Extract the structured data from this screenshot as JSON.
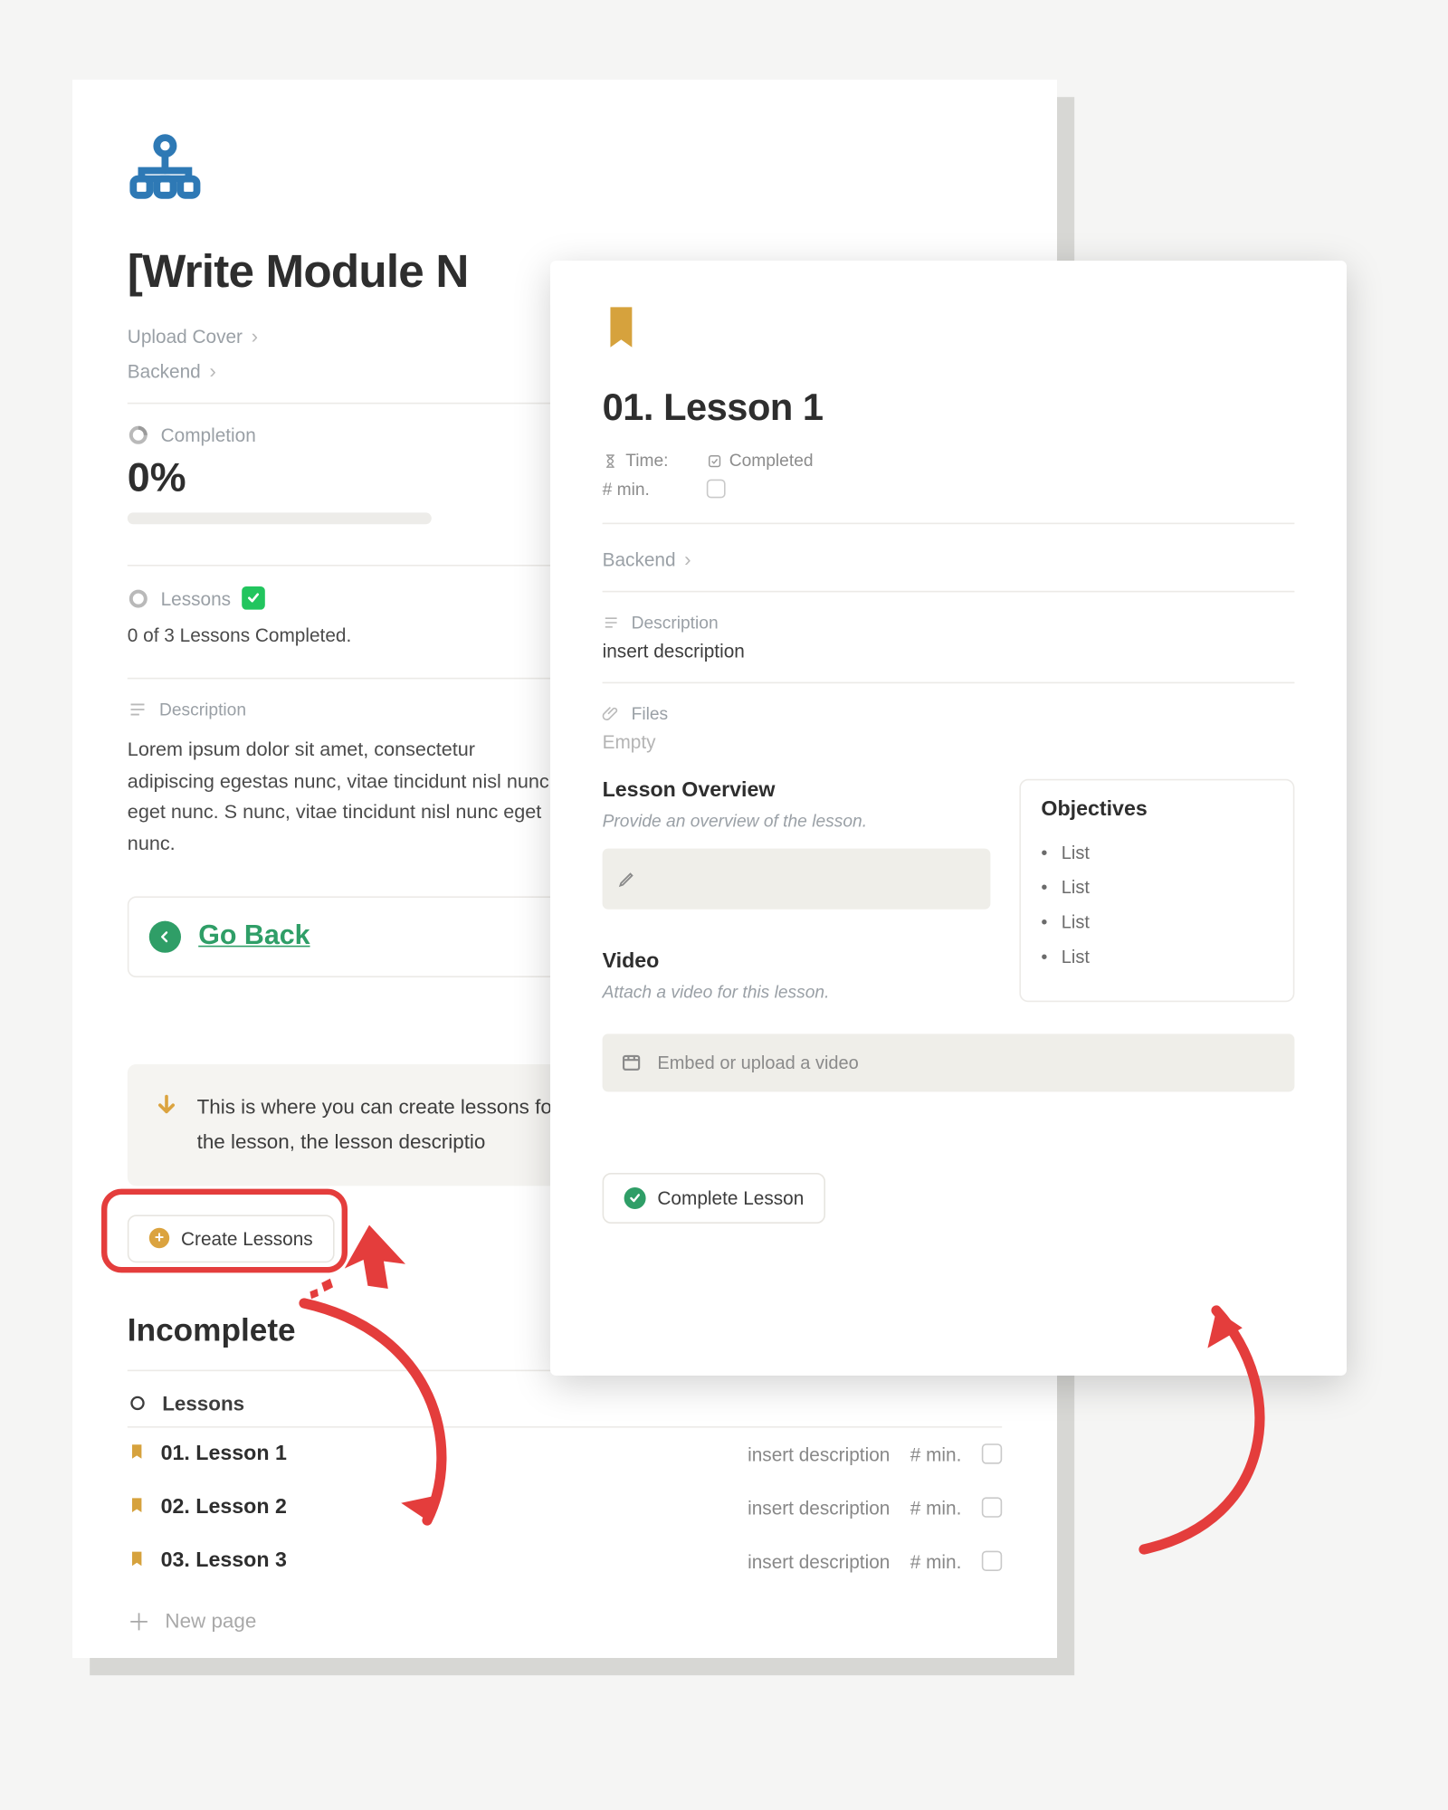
{
  "module": {
    "title": "[Write Module N",
    "upload_cover": "Upload Cover",
    "breadcrumb": "Backend",
    "completion_label": "Completion",
    "completion_value": "0%",
    "lessons_label": "Lessons",
    "lessons_progress": "0 of 3 Lessons Completed.",
    "description_label": "Description",
    "description_text": "Lorem ipsum dolor sit amet, consectetur adipiscing egestas nunc, vitae tincidunt nisl nunc eget nunc. S nunc, vitae tincidunt nisl nunc eget nunc.",
    "go_back": "Go Back",
    "callout_text": "This is where you can create lessons fo Lessons\" button below. This will create title of the lesson, the lesson descriptio",
    "create_btn": "Create Lessons",
    "section_incomplete": "Incomplete",
    "lessons_header": "Lessons",
    "new_page": "New page",
    "lesson_rows": [
      {
        "title": "01. Lesson 1",
        "desc": "insert description",
        "time": "# min."
      },
      {
        "title": "02. Lesson 2",
        "desc": "insert description",
        "time": "# min."
      },
      {
        "title": "03. Lesson 3",
        "desc": "insert description",
        "time": "# min."
      }
    ]
  },
  "lesson": {
    "title": "01. Lesson 1",
    "time_label": "Time:",
    "time_value": "# min.",
    "completed_label": "Completed",
    "breadcrumb": "Backend",
    "description_label": "Description",
    "description_value": "insert description",
    "files_label": "Files",
    "files_value": "Empty",
    "overview_title": "Lesson Overview",
    "overview_hint": "Provide an overview of the lesson.",
    "objectives_title": "Objectives",
    "objectives": [
      "List",
      "List",
      "List",
      "List"
    ],
    "video_title": "Video",
    "video_hint": "Attach a video for this lesson.",
    "video_placeholder": "Embed or upload a video",
    "complete_btn": "Complete Lesson"
  }
}
